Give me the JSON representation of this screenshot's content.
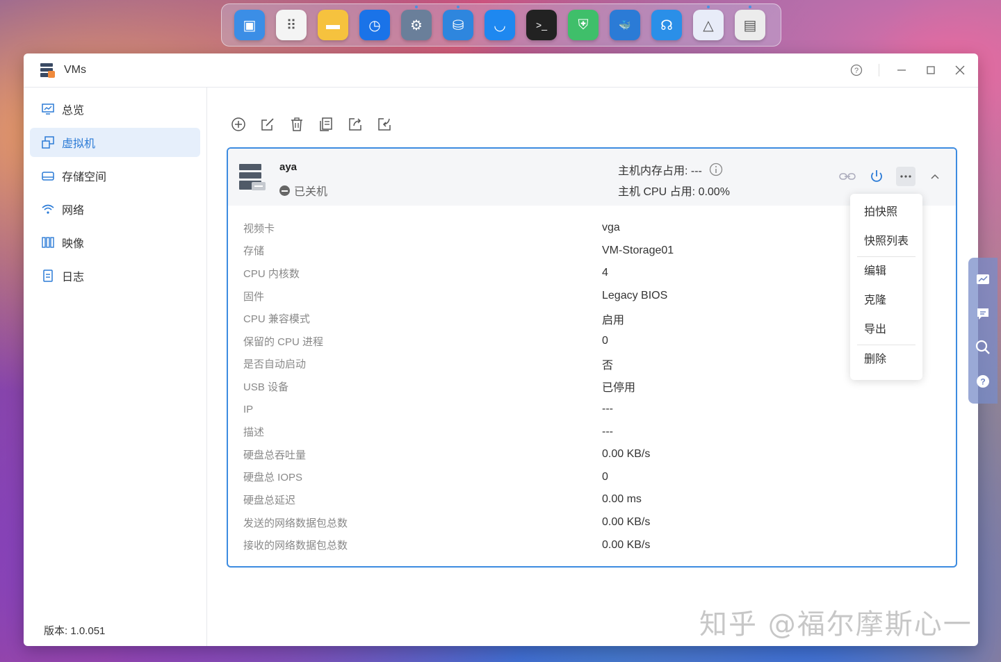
{
  "dock": {
    "apps": [
      {
        "name": "vms-app",
        "color": "#3b8ee6",
        "glyph": "▣"
      },
      {
        "name": "app-center",
        "color": "#f4f4f4",
        "glyph": "⠿"
      },
      {
        "name": "files",
        "color": "#f6c23e",
        "glyph": "▬"
      },
      {
        "name": "backup",
        "color": "#1a73e8",
        "glyph": "◷"
      },
      {
        "name": "settings",
        "color": "#6a7f9a",
        "glyph": "⚙"
      },
      {
        "name": "storage-manager",
        "color": "#2e86de",
        "glyph": "⛁"
      },
      {
        "name": "app-store",
        "color": "#1e88f0",
        "glyph": "◡"
      },
      {
        "name": "terminal",
        "color": "#222222",
        "glyph": ">_"
      },
      {
        "name": "security",
        "color": "#3fbf6a",
        "glyph": "⛨"
      },
      {
        "name": "docker",
        "color": "#2b7bd6",
        "glyph": "🐳"
      },
      {
        "name": "support",
        "color": "#2a8fe8",
        "glyph": "☊"
      },
      {
        "name": "media",
        "color": "#e8ecf8",
        "glyph": "△"
      },
      {
        "name": "vms-active",
        "color": "#ececec",
        "glyph": "▤"
      }
    ]
  },
  "window": {
    "title": "VMs"
  },
  "sidebar": {
    "items": [
      {
        "label": "总览",
        "icon": "monitor-icon"
      },
      {
        "label": "虚拟机",
        "icon": "vm-icon"
      },
      {
        "label": "存储空间",
        "icon": "disk-icon"
      },
      {
        "label": "网络",
        "icon": "wifi-icon"
      },
      {
        "label": "映像",
        "icon": "image-icon"
      },
      {
        "label": "日志",
        "icon": "log-icon"
      }
    ],
    "active_index": 1,
    "version": "版本: 1.0.051"
  },
  "vm": {
    "name": "aya",
    "status": "已关机",
    "mem_usage": "主机内存占用: ---",
    "cpu_usage": "主机 CPU 占用: 0.00%",
    "details": [
      {
        "k": "视频卡",
        "v": "vga"
      },
      {
        "k": "存储",
        "v": "VM-Storage01"
      },
      {
        "k": "CPU 内核数",
        "v": "4"
      },
      {
        "k": "固件",
        "v": "Legacy BIOS"
      },
      {
        "k": "CPU 兼容模式",
        "v": "启用"
      },
      {
        "k": "保留的 CPU 进程",
        "v": "0"
      },
      {
        "k": "是否自动启动",
        "v": "否"
      },
      {
        "k": "USB 设备",
        "v": "已停用"
      },
      {
        "k": "IP",
        "v": "---"
      },
      {
        "k": "描述",
        "v": "---"
      },
      {
        "k": "硬盘总吞吐量",
        "v": "0.00 KB/s"
      },
      {
        "k": "硬盘总 IOPS",
        "v": "0"
      },
      {
        "k": "硬盘总延迟",
        "v": "0.00 ms"
      },
      {
        "k": "发送的网络数据包总数",
        "v": "0.00 KB/s"
      },
      {
        "k": "接收的网络数据包总数",
        "v": "0.00 KB/s"
      }
    ]
  },
  "menu": {
    "items": [
      "拍快照",
      "快照列表",
      "编辑",
      "克隆",
      "导出",
      "删除"
    ]
  },
  "watermark": "知乎 @福尔摩斯心一",
  "colors": {
    "accent": "#2a7ad6",
    "card_border": "#3c8be0"
  }
}
